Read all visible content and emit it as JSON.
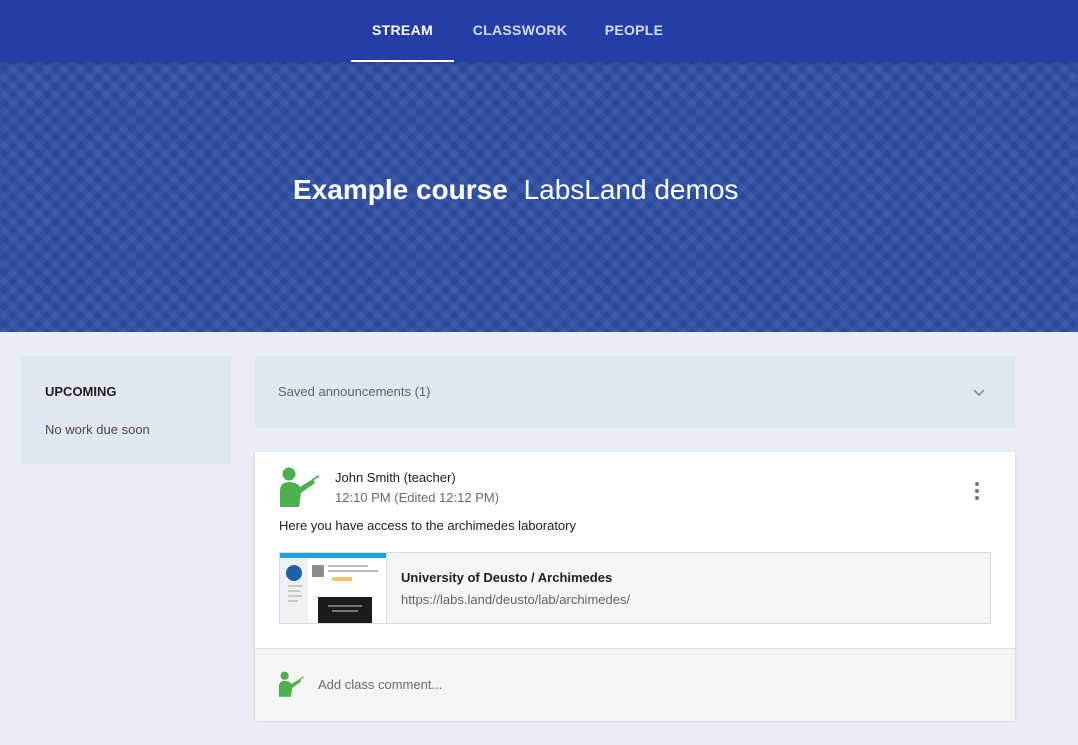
{
  "nav": {
    "tabs": [
      {
        "label": "STREAM",
        "active": true
      },
      {
        "label": "CLASSWORK",
        "active": false
      },
      {
        "label": "PEOPLE",
        "active": false
      }
    ]
  },
  "banner": {
    "course_name": "Example course",
    "section": "LabsLand demos"
  },
  "upcoming": {
    "title": "UPCOMING",
    "empty_text": "No work due soon"
  },
  "saved_announcements": {
    "label": "Saved announcements (1)",
    "icon": "chevron-down-icon"
  },
  "post": {
    "author": "John Smith (teacher)",
    "timestamp": "12:10 PM (Edited 12:12 PM)",
    "text": "Here you have access to the archimedes laboratory",
    "attachment": {
      "title": "University of Deusto / Archimedes",
      "url": "https://labs.land/deusto/lab/archimedes/"
    },
    "comment_placeholder": "Add class comment..."
  },
  "colors": {
    "nav_bg": "#253da8",
    "banner_bg": "#2d4fa3",
    "page_bg": "#e8edf8",
    "avatar_green": "#4caf50"
  }
}
